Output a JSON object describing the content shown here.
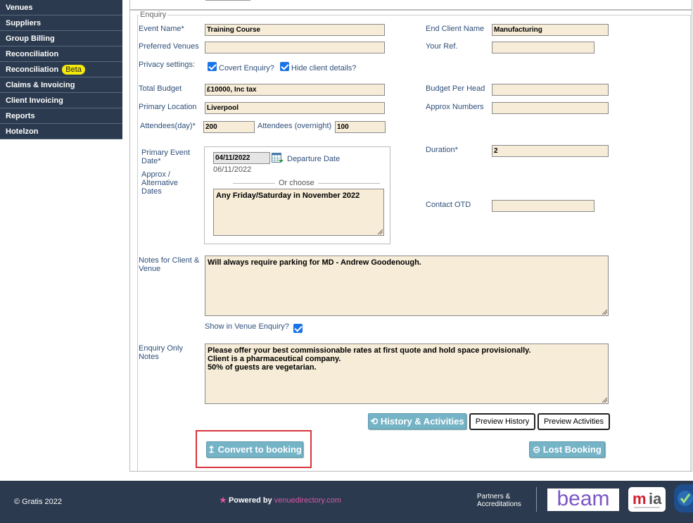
{
  "sidebar": {
    "items": [
      {
        "label": "Venues"
      },
      {
        "label": "Suppliers"
      },
      {
        "label": "Group Billing"
      },
      {
        "label": "Reconciliation"
      },
      {
        "label": "Reconciliation",
        "badge": "Beta"
      },
      {
        "label": "Claims & Invoicing"
      },
      {
        "label": "Client Invoicing"
      },
      {
        "label": "Reports"
      },
      {
        "label": "Hotelzon"
      }
    ]
  },
  "form": {
    "legend": "Enquiry",
    "event_name": {
      "label": "Event Name*",
      "value": "Training Course"
    },
    "end_client_name": {
      "label": "End Client Name",
      "value": "Manufacturing"
    },
    "preferred_venues": {
      "label": "Preferred Venues",
      "value": ""
    },
    "your_ref": {
      "label": "Your Ref.",
      "value": ""
    },
    "privacy": {
      "label": "Privacy settings:",
      "covert": {
        "label": "Covert Enquiry?",
        "checked": true
      },
      "hide_client": {
        "label": "Hide client details?",
        "checked": true
      }
    },
    "total_budget": {
      "label": "Total Budget",
      "value": "£10000, Inc tax"
    },
    "budget_per_head": {
      "label": "Budget Per Head",
      "value": ""
    },
    "primary_location": {
      "label": "Primary Location",
      "value": "Liverpool"
    },
    "approx_numbers": {
      "label": "Approx Numbers",
      "value": ""
    },
    "attendees_day": {
      "label": "Attendees(day)*",
      "value": "200"
    },
    "attendees_overnight": {
      "label": "Attendees (overnight)",
      "value": "100"
    },
    "primary_event_date": {
      "label": "Primary Event Date*",
      "value": "04/11/2022"
    },
    "departure_date": {
      "label": "Departure Date",
      "value": "06/11/2022"
    },
    "approx_dates": {
      "label": "Approx / Alternative Dates"
    },
    "or_choose": "Or choose",
    "alt_dates_text": "Any Friday/Saturday in November 2022",
    "duration": {
      "label": "Duration*",
      "value": "2"
    },
    "contact_otd": {
      "label": "Contact OTD",
      "value": ""
    },
    "notes_client_venue": {
      "label": "Notes for Client & Venue",
      "value": "Will always require parking for MD - Andrew Goodenough."
    },
    "show_in_venue": {
      "label": "Show in Venue Enquiry?",
      "checked": true
    },
    "enquiry_only_notes": {
      "label": "Enquiry Only Notes",
      "lines": [
        "Please offer your best commissionable rates at first quote and hold space provisionally.",
        "Client is a pharmaceutical company.",
        "50% of guests are vegetarian."
      ]
    }
  },
  "buttons": {
    "history_activities": "History & Activities",
    "preview_history": "Preview History",
    "preview_activities": "Preview Activities",
    "convert_to_booking": "Convert to booking",
    "lost_booking": "Lost Booking"
  },
  "footer": {
    "copyright": "© Gratis 2022",
    "powered_by": "Powered by",
    "powered_brand": "venuedirectory.com",
    "partners_line1": "Partners &",
    "partners_line2": "Accreditations",
    "logo_beam": "beam",
    "logo_mia": "mia"
  },
  "colors": {
    "sidebar_bg": "#2b3a4e",
    "field_bg": "#f6ecd7",
    "label_color": "#2f4f7a",
    "teal_button": "#75b3c6",
    "highlight": "#d8343a",
    "beta_badge": "#f5e90b"
  }
}
